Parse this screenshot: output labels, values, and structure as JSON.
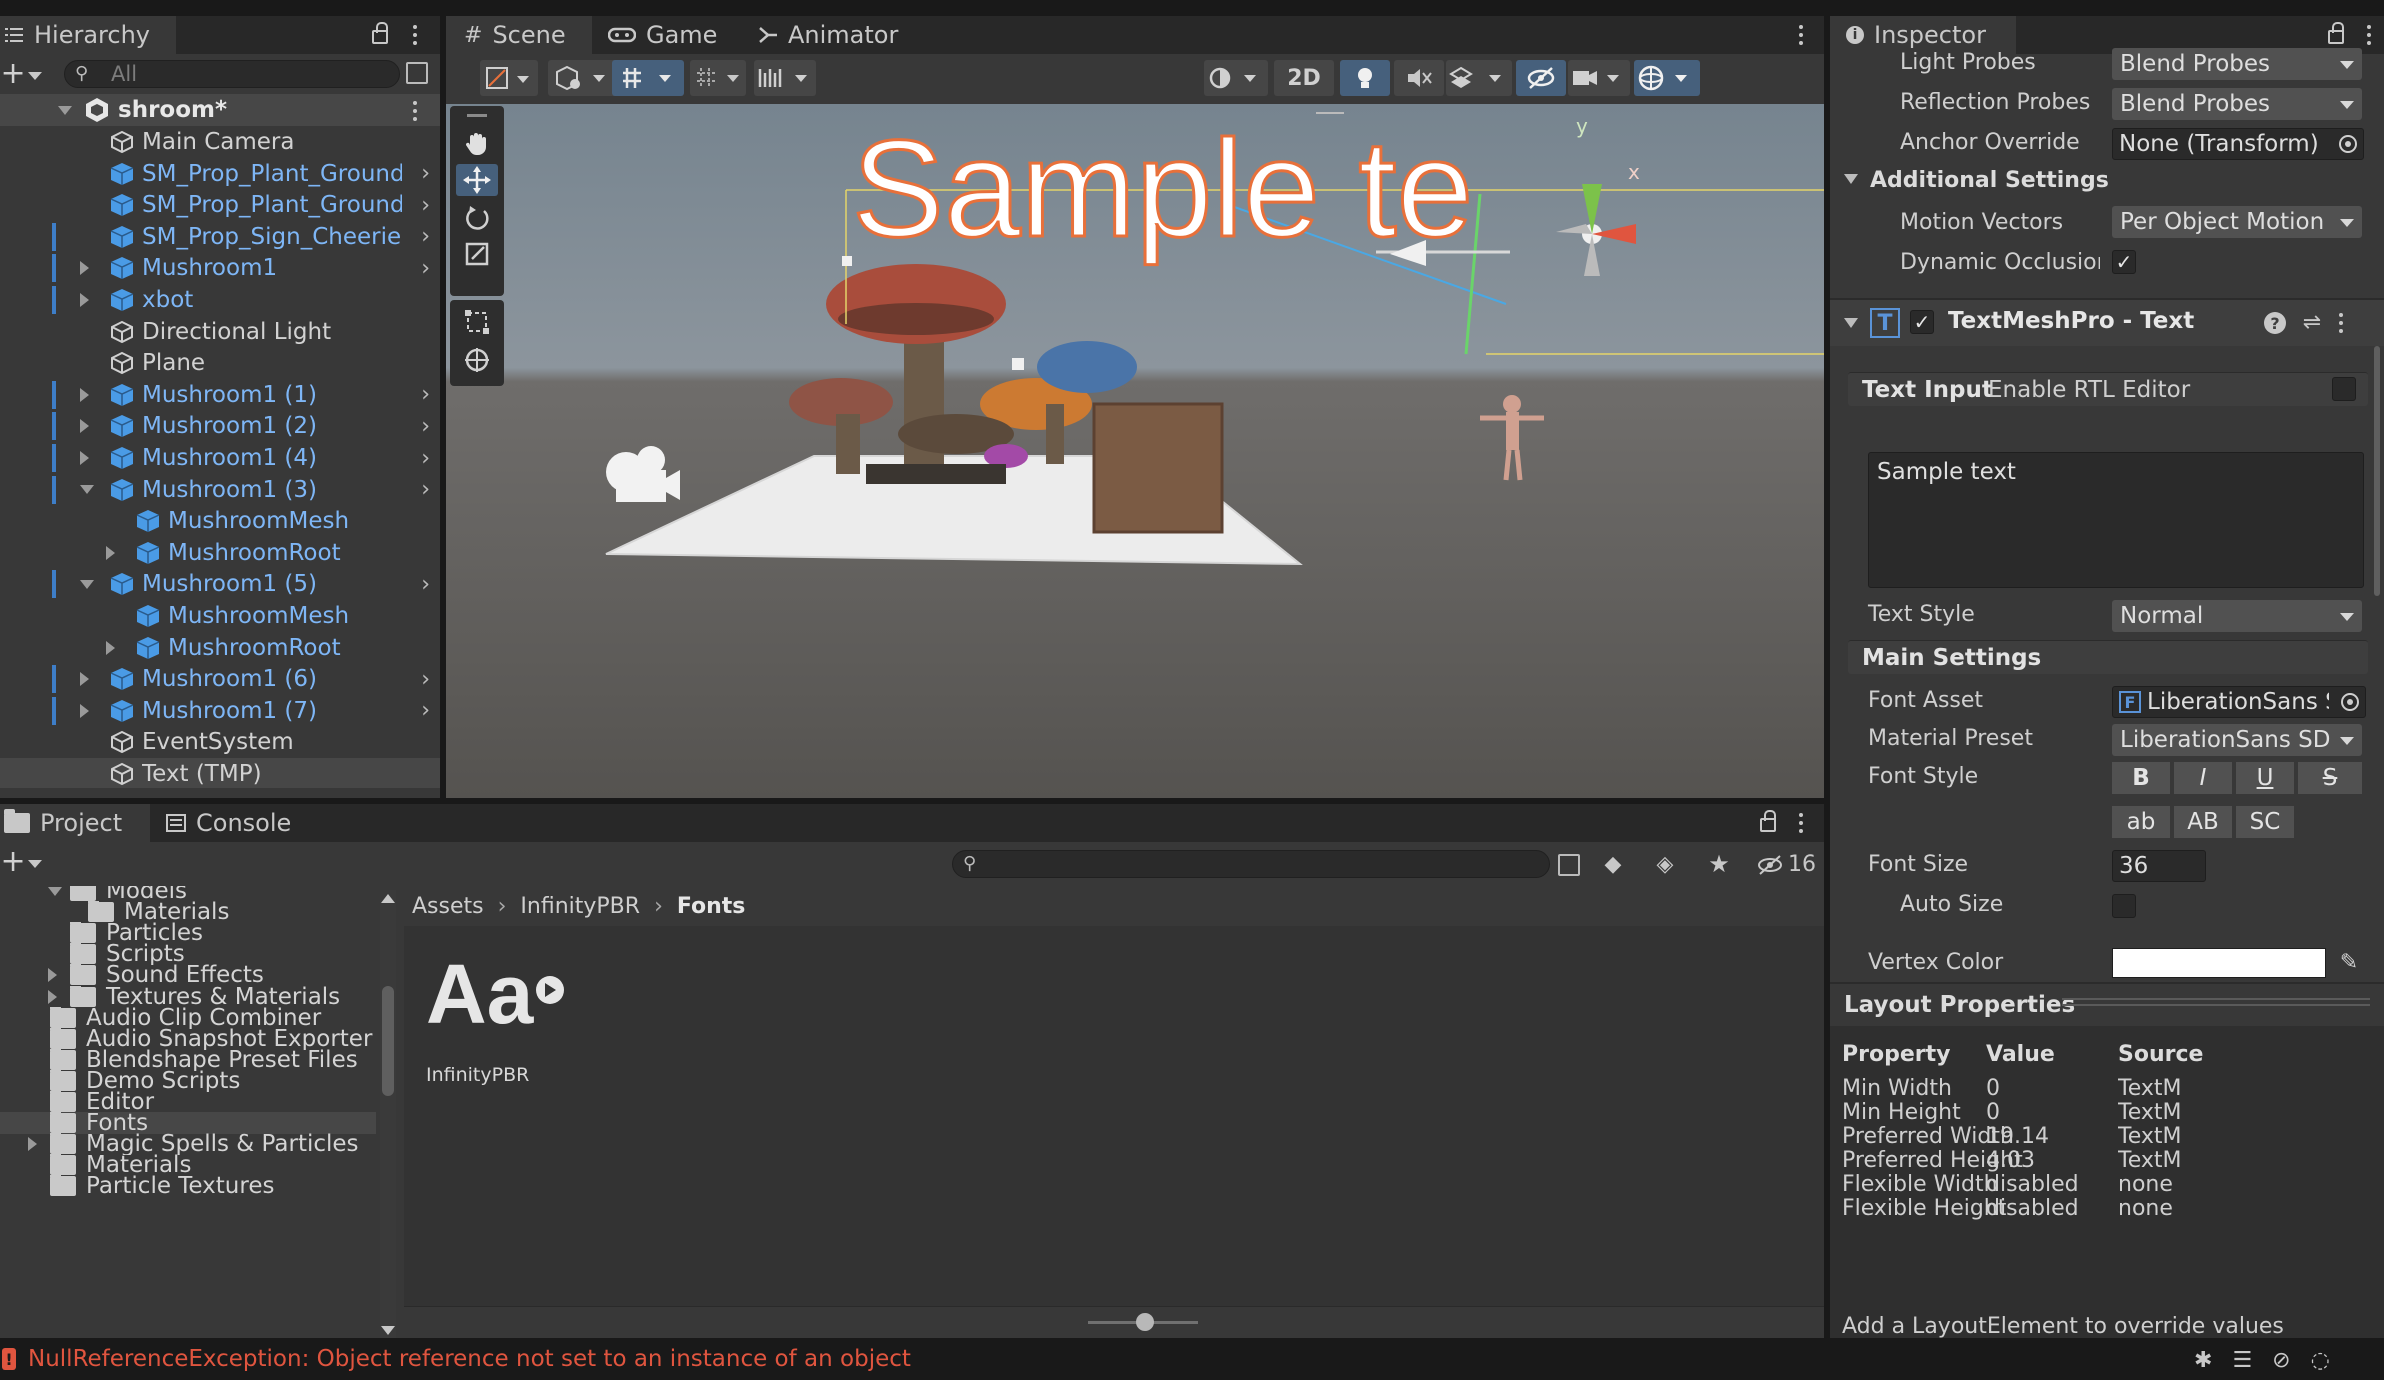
{
  "hierarchy": {
    "tab_label": "Hierarchy",
    "search_placeholder": "All",
    "scene_name": "shroom*",
    "items": [
      {
        "label": "Main Camera",
        "blue": false
      },
      {
        "label": "SM_Prop_Plant_Ground_",
        "blue": true
      },
      {
        "label": "SM_Prop_Plant_Ground_",
        "blue": true
      },
      {
        "label": "SM_Prop_Sign_Cheeries",
        "blue": true
      },
      {
        "label": "Mushroom1",
        "blue": true
      },
      {
        "label": "xbot",
        "blue": true
      },
      {
        "label": "Directional Light",
        "blue": false
      },
      {
        "label": "Plane",
        "blue": false
      },
      {
        "label": "Mushroom1 (1)",
        "blue": true
      },
      {
        "label": "Mushroom1 (2)",
        "blue": true
      },
      {
        "label": "Mushroom1 (4)",
        "blue": true
      },
      {
        "label": "Mushroom1 (3)",
        "blue": true
      },
      {
        "label": "MushroomMesh",
        "blue": true
      },
      {
        "label": "MushroomRoot",
        "blue": true
      },
      {
        "label": "Mushroom1 (5)",
        "blue": true
      },
      {
        "label": "MushroomMesh",
        "blue": true
      },
      {
        "label": "MushroomRoot",
        "blue": true
      },
      {
        "label": "Mushroom1 (6)",
        "blue": true
      },
      {
        "label": "Mushroom1 (7)",
        "blue": true
      },
      {
        "label": "EventSystem",
        "blue": false
      },
      {
        "label": "Text (TMP)",
        "blue": false
      }
    ]
  },
  "scene": {
    "tabs": [
      "Scene",
      "Game",
      "Animator"
    ],
    "mode_2d": "2D",
    "world_text": "Sample te",
    "gizmo_y": "y",
    "gizmo_x": "x"
  },
  "inspector": {
    "tab_label": "Inspector",
    "light_probes_label": "Light Probes",
    "light_probes_value": "Blend Probes",
    "reflection_probes_label": "Reflection Probes",
    "reflection_probes_value": "Blend Probes",
    "anchor_override_label": "Anchor Override",
    "anchor_override_value": "None (Transform)",
    "additional_settings": "Additional Settings",
    "motion_vectors_label": "Motion Vectors",
    "motion_vectors_value": "Per Object Motion",
    "dynamic_occlusion_label": "Dynamic Occlusion",
    "component_title": "TextMeshPro - Text",
    "text_input_header": "Text Input",
    "enable_rtl": "Enable RTL Editor",
    "text_value": "Sample text",
    "text_style_label": "Text Style",
    "text_style_value": "Normal",
    "main_settings": "Main Settings",
    "font_asset_label": "Font Asset",
    "font_asset_value": "LiberationSans SDF",
    "material_preset_label": "Material Preset",
    "material_preset_value": "LiberationSans SDF Material",
    "font_style_label": "Font Style",
    "font_style_buttons": [
      "B",
      "I",
      "U",
      "S"
    ],
    "font_case_buttons": [
      "ab",
      "AB",
      "SC"
    ],
    "font_size_label": "Font Size",
    "font_size_value": "36",
    "auto_size_label": "Auto Size",
    "vertex_color_label": "Vertex Color",
    "vertex_color": "#ffffff",
    "layout_properties": "Layout Properties",
    "layout_headers": [
      "Property",
      "Value",
      "Source"
    ],
    "layout_rows": [
      [
        "Min Width",
        "0",
        "TextMeshPro"
      ],
      [
        "Min Height",
        "0",
        "TextMeshPro"
      ],
      [
        "Preferred Width",
        "19.14",
        "TextMeshPro"
      ],
      [
        "Preferred Height",
        "4.03",
        "TextMeshPro"
      ],
      [
        "Flexible Width",
        "disabled",
        "none"
      ],
      [
        "Flexible Height",
        "disabled",
        "none"
      ]
    ],
    "layout_footer": "Add a LayoutElement to override values"
  },
  "project": {
    "tabs": [
      "Project",
      "Console"
    ],
    "hidden_count": "16",
    "breadcrumb": [
      "Assets",
      "InfinityPBR",
      "Fonts"
    ],
    "folders": [
      {
        "label": "Models",
        "depth": 2,
        "expand": "down"
      },
      {
        "label": "Materials",
        "depth": 3,
        "expand": "none"
      },
      {
        "label": "Particles",
        "depth": 2,
        "expand": "none"
      },
      {
        "label": "Scripts",
        "depth": 2,
        "expand": "none"
      },
      {
        "label": "Sound Effects",
        "depth": 2,
        "expand": "right"
      },
      {
        "label": "Textures & Materials",
        "depth": 2,
        "expand": "right"
      },
      {
        "label": "Audio Clip Combiner",
        "depth": 1,
        "expand": "none"
      },
      {
        "label": "Audio Snapshot Exporter",
        "depth": 1,
        "expand": "none"
      },
      {
        "label": "Blendshape Preset Files",
        "depth": 1,
        "expand": "none"
      },
      {
        "label": "Demo Scripts",
        "depth": 1,
        "expand": "none"
      },
      {
        "label": "Editor",
        "depth": 1,
        "expand": "none"
      },
      {
        "label": "Fonts",
        "depth": 1,
        "expand": "none",
        "selected": true
      },
      {
        "label": "Magic Spells & Particles",
        "depth": 1,
        "expand": "right"
      },
      {
        "label": "Materials",
        "depth": 1,
        "expand": "none"
      },
      {
        "label": "Particle Textures",
        "depth": 1,
        "expand": "none"
      }
    ],
    "asset_glyph": "Aa",
    "asset_label": "InfinityPBR"
  },
  "status": {
    "error_text": "NullReferenceException: Object reference not set to an instance of an object",
    "error_color": "#e0553f"
  }
}
